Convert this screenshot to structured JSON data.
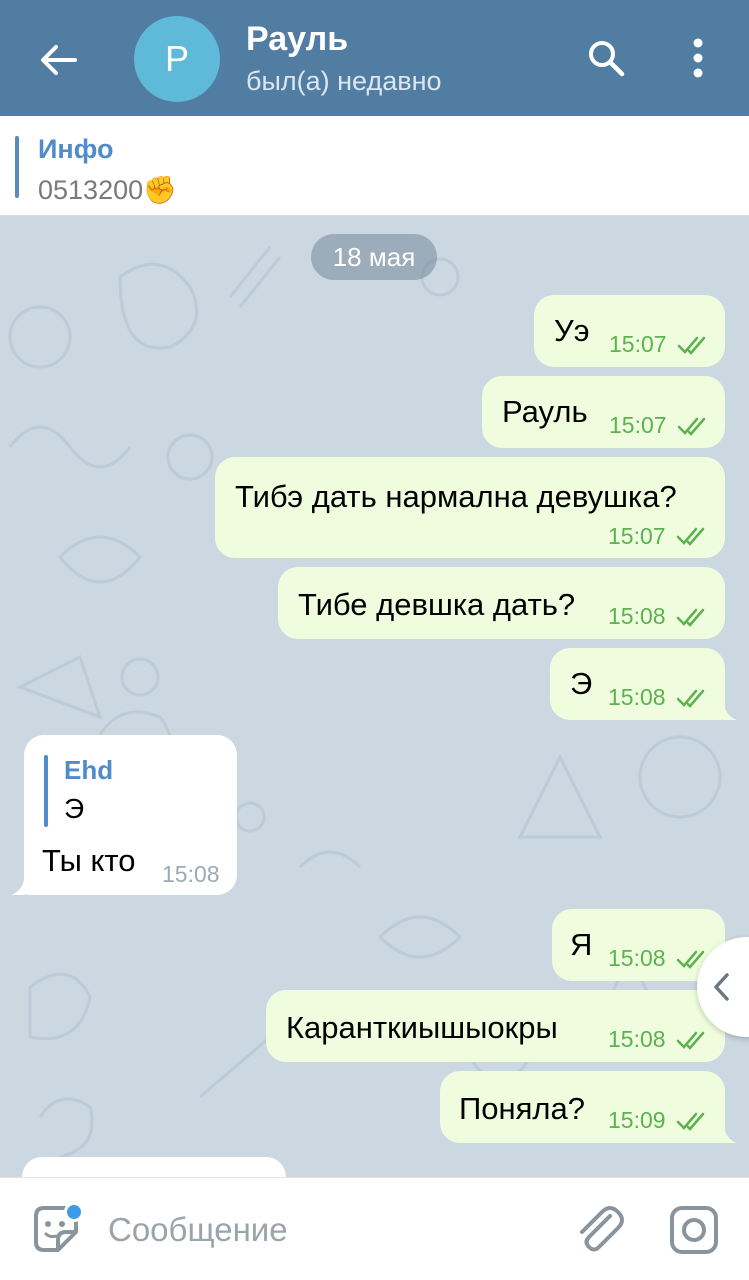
{
  "header": {
    "back_icon": "arrow-left-icon",
    "avatar_letter": "Р",
    "avatar_color": "#5fb9d8",
    "contact_name": "Рауль",
    "status": "был(а) недавно",
    "search_icon": "search-icon",
    "menu_icon": "more-vertical-icon"
  },
  "pinned": {
    "title": "Инфо",
    "text": "0513200✊"
  },
  "chat": {
    "date_label": "18 мая",
    "messages": [
      {
        "direction": "out",
        "text": "Уэ",
        "time": "15:07",
        "read": true
      },
      {
        "direction": "out",
        "text": "Рауль",
        "time": "15:07",
        "read": true
      },
      {
        "direction": "out",
        "text": "Тибэ дать нармална девушка?",
        "time": "15:07",
        "read": true
      },
      {
        "direction": "out",
        "text": "Тибе девшка дать?",
        "time": "15:08",
        "read": true
      },
      {
        "direction": "out",
        "text": "Э",
        "time": "15:08",
        "read": true
      },
      {
        "direction": "in",
        "reply_name": "Ehd",
        "reply_text": "Э",
        "text": "Ты кто",
        "time": "15:08"
      },
      {
        "direction": "out",
        "text": "Я",
        "time": "15:08",
        "read": true
      },
      {
        "direction": "out",
        "text": "Каранткиышыокры",
        "time": "15:08",
        "read": true
      },
      {
        "direction": "out",
        "text": "Поняла?",
        "time": "15:09",
        "read": true
      }
    ]
  },
  "input": {
    "placeholder": "Сообщение",
    "value": "",
    "sticker_icon": "sticker-icon",
    "attach_icon": "paperclip-icon",
    "camera_icon": "camera-icon"
  },
  "colors": {
    "header_bg": "#517da2",
    "outgoing_bubble": "#effdde",
    "incoming_bubble": "#ffffff",
    "time_green": "#5bb24f",
    "accent_blue": "#4f8cc9"
  }
}
